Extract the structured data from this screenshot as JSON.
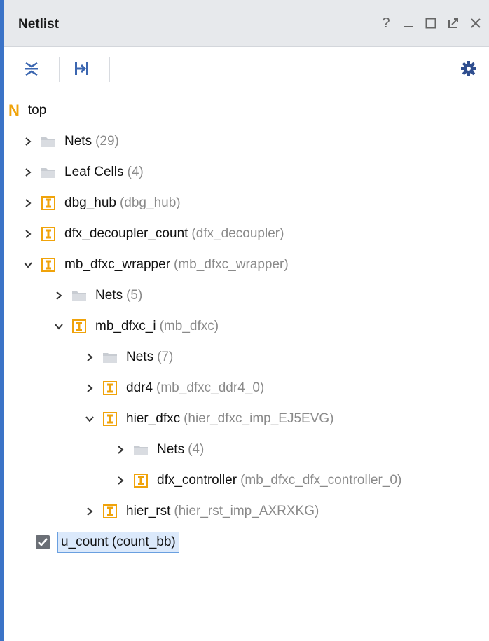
{
  "panel": {
    "title": "Netlist",
    "controls": [
      "?",
      "_",
      "☐",
      "⧉",
      "✕"
    ]
  },
  "toolbar": {
    "collapse_all": "collapse-all-icon",
    "expand_hierarchy": "expand-icon",
    "settings": "gear-icon"
  },
  "tree": {
    "root": {
      "label": "top",
      "badge": "N"
    },
    "items": [
      {
        "label": "Nets",
        "sub": "(29)"
      },
      {
        "label": "Leaf Cells",
        "sub": "(4)"
      },
      {
        "label": "dbg_hub",
        "sub": "(dbg_hub)"
      },
      {
        "label": "dfx_decoupler_count",
        "sub": "(dfx_decoupler)"
      },
      {
        "label": "mb_dfxc_wrapper",
        "sub": "(mb_dfxc_wrapper)"
      },
      {
        "label": "Nets",
        "sub": "(5)"
      },
      {
        "label": "mb_dfxc_i",
        "sub": "(mb_dfxc)"
      },
      {
        "label": "Nets",
        "sub": "(7)"
      },
      {
        "label": "ddr4",
        "sub": "(mb_dfxc_ddr4_0)"
      },
      {
        "label": "hier_dfxc",
        "sub": "(hier_dfxc_imp_EJ5EVG)"
      },
      {
        "label": "Nets",
        "sub": "(4)"
      },
      {
        "label": "dfx_controller",
        "sub": "(mb_dfxc_dfx_controller_0)"
      },
      {
        "label": "hier_rst",
        "sub": "(hier_rst_imp_AXRXKG)"
      }
    ],
    "selected": {
      "label": "u_count (count_bb)",
      "checked": true
    }
  },
  "colors": {
    "accent_border": "#3b73c7",
    "cell_icon": "#f0a30a",
    "folder_icon": "#c8ccd2",
    "root_badge": "#f0a30a",
    "sub_text": "#8a8a8a"
  }
}
